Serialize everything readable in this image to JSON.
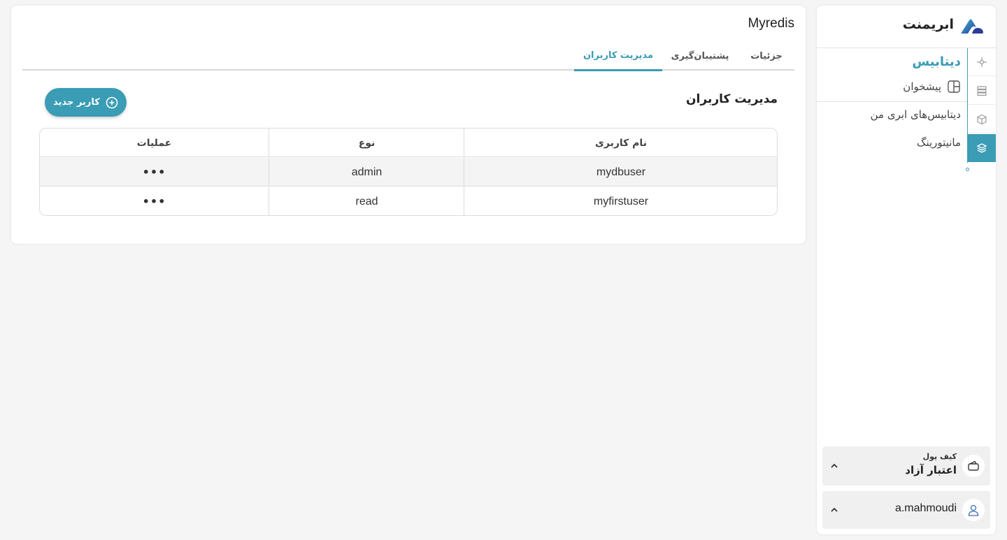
{
  "brand": {
    "name": "ابریمنت"
  },
  "sidebar": {
    "title": "دیتابیس",
    "items": [
      {
        "label": "پیشخوان",
        "icon": "dashboard-icon"
      },
      {
        "label": "دیتابیس‌های ابری من"
      },
      {
        "label": "مانیتورینگ"
      }
    ],
    "rail_icons": [
      "kubernetes-icon",
      "server-icon",
      "cube-icon",
      "layers-icon"
    ],
    "wallet": {
      "label": "کیف پول",
      "value": "اعتبار آزاد",
      "icon": "wallet-icon"
    },
    "user": {
      "name": "a.mahmoudi",
      "icon": "user-icon"
    }
  },
  "main": {
    "title": "Myredis",
    "tabs": [
      {
        "label": "جزئیات",
        "active": false
      },
      {
        "label": "پشتیبان‌گیری",
        "active": false
      },
      {
        "label": "مدیریت کاربران",
        "active": true
      }
    ],
    "section_title": "مدیریت کاربران",
    "new_user_button": "کاربر جدید",
    "table": {
      "columns": [
        "نام کاربری",
        "نوع",
        "عملیات"
      ],
      "rows": [
        {
          "username": "mydbuser",
          "type": "admin",
          "ops": "•••"
        },
        {
          "username": "myfirstuser",
          "type": "read",
          "ops": "•••"
        }
      ]
    }
  },
  "colors": {
    "accent": "#3a9cb5",
    "background": "#f5f5f5"
  }
}
